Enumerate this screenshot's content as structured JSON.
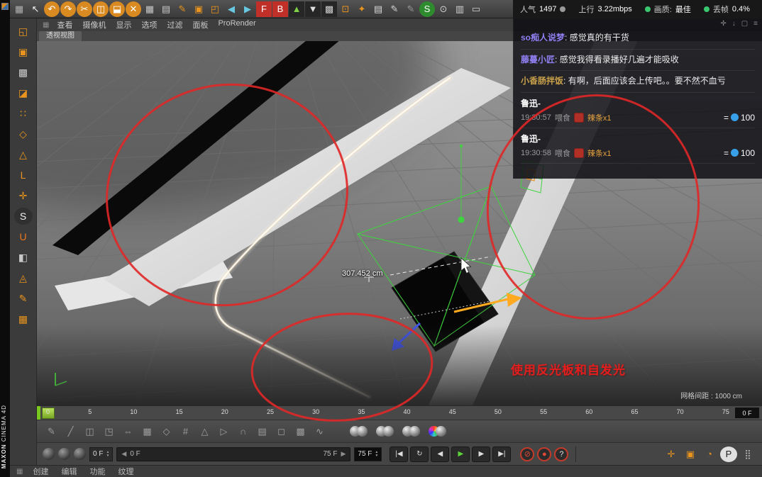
{
  "colors": {
    "green": "#3ac86e",
    "gray": "#9a9a9a",
    "blue": "#38a0e8",
    "annotation_red": "#e51d1d"
  },
  "brand": {
    "maxon": "MAXON",
    "cinema": "CINEMA 4D"
  },
  "stats": {
    "popularity_label": "人气",
    "popularity_value": "1497",
    "upload_label": "上行",
    "upload_value": "3.22mbps",
    "quality_label": "画质:",
    "quality_value": "最佳",
    "dropframe_label": "丢帧",
    "dropframe_value": "0.4%"
  },
  "topbar": {
    "icons": [
      {
        "name": "snap-grid-icon",
        "glyph": "▦",
        "fg": "#b0b0b0"
      },
      {
        "name": "cursor-icon",
        "glyph": "↖",
        "fg": "#f0f0f0"
      },
      {
        "name": "undo-icon",
        "glyph": "↶",
        "fg": "#fff",
        "bg": "#d98a20",
        "radius": "50%"
      },
      {
        "name": "redo-icon",
        "glyph": "↷",
        "fg": "#fff",
        "bg": "#d98a20",
        "radius": "50%"
      },
      {
        "name": "cut-icon",
        "glyph": "✂",
        "fg": "#fff",
        "bg": "#d98a20",
        "radius": "50%"
      },
      {
        "name": "copy-icon",
        "glyph": "◫",
        "fg": "#fff",
        "bg": "#d98a20",
        "radius": "50%"
      },
      {
        "name": "paste-icon",
        "glyph": "⬓",
        "fg": "#fff",
        "bg": "#d98a20",
        "radius": "50%"
      },
      {
        "name": "delete-icon",
        "glyph": "✕",
        "fg": "#fff",
        "bg": "#d98a20",
        "radius": "50%"
      },
      {
        "name": "workplane-icon",
        "glyph": "▦",
        "fg": "#c8c8c8"
      },
      {
        "name": "modeling-axis-icon",
        "glyph": "▤",
        "fg": "#c8c8c8"
      },
      {
        "name": "make-editable-icon",
        "glyph": "✎",
        "fg": "#e8941e"
      },
      {
        "name": "model-cube-icon",
        "glyph": "▣",
        "fg": "#e8941e"
      },
      {
        "name": "array-cube-icon",
        "glyph": "◰",
        "fg": "#e8941e"
      },
      {
        "name": "nav-back-icon",
        "glyph": "◀",
        "fg": "#68c8e0"
      },
      {
        "name": "nav-forward-icon",
        "glyph": "▶",
        "fg": "#68c8e0"
      },
      {
        "name": "front-view-icon",
        "glyph": "F",
        "fg": "#fff",
        "bg": "#c03028"
      },
      {
        "name": "back-view-icon",
        "glyph": "B",
        "fg": "#fff",
        "bg": "#c03028"
      },
      {
        "name": "arrow-up-icon",
        "glyph": "▲",
        "fg": "#7ed048",
        "bg": "#262626"
      },
      {
        "name": "arrow-down-icon",
        "glyph": "▼",
        "fg": "#e0e0e0",
        "bg": "#262626"
      },
      {
        "name": "checker-icon",
        "glyph": "▩",
        "fg": "#d0d0d0",
        "bg": "#262626"
      },
      {
        "name": "target-icon",
        "glyph": "⊡",
        "fg": "#e8941e"
      },
      {
        "name": "star-icon",
        "glyph": "✦",
        "fg": "#e8941e"
      },
      {
        "name": "render-doc-icon",
        "glyph": "▤",
        "fg": "#d8d8d8"
      },
      {
        "name": "pen-a-icon",
        "glyph": "✎",
        "fg": "#d8d8d8"
      },
      {
        "name": "pen-b-icon",
        "glyph": "✎",
        "fg": "#989898"
      },
      {
        "name": "shader-ball-icon",
        "glyph": "S",
        "fg": "#fff",
        "bg": "#2e8c2e",
        "radius": "50%"
      },
      {
        "name": "picker-icon",
        "glyph": "⊙",
        "fg": "#d0d0d0"
      },
      {
        "name": "layers-icon",
        "glyph": "▥",
        "fg": "#d0d0d0"
      },
      {
        "name": "screen-icon",
        "glyph": "▭",
        "fg": "#d0d0d0"
      }
    ]
  },
  "menubar": {
    "items": [
      "查看",
      "摄像机",
      "显示",
      "选项",
      "过滤",
      "面板",
      "ProRender"
    ]
  },
  "left_toolbar": {
    "icons": [
      {
        "name": "convert-editable-icon",
        "glyph": "◱",
        "fg": "#e8941e"
      },
      {
        "name": "model-mode-icon",
        "glyph": "▣",
        "fg": "#e8941e"
      },
      {
        "name": "texture-mode-icon",
        "glyph": "▩",
        "fg": "#c8c8c8"
      },
      {
        "name": "workplane-mode-icon",
        "glyph": "◪",
        "fg": "#e8941e"
      },
      {
        "name": "points-mode-icon",
        "glyph": "∷",
        "fg": "#e8941e"
      },
      {
        "name": "edges-mode-icon",
        "glyph": "◇",
        "fg": "#e8941e"
      },
      {
        "name": "polygons-mode-icon",
        "glyph": "△",
        "fg": "#e8941e"
      },
      {
        "name": "axis-mode-icon",
        "glyph": "L",
        "fg": "#e8941e"
      },
      {
        "name": "object-axis-icon",
        "glyph": "✛",
        "fg": "#e8941e"
      },
      {
        "name": "scale-tool-icon",
        "glyph": "S",
        "fg": "#f0f0f0",
        "bg": "#303030",
        "radius": "50%"
      },
      {
        "name": "snap-magnet-icon",
        "glyph": "U",
        "fg": "#e87820"
      },
      {
        "name": "lock-workplane-icon",
        "glyph": "◧",
        "fg": "#c8c8c8"
      },
      {
        "name": "quantize-icon",
        "glyph": "◬",
        "fg": "#e8941e"
      },
      {
        "name": "brush-icon",
        "glyph": "✎",
        "fg": "#e8941e"
      },
      {
        "name": "clapper-icon",
        "glyph": "▦",
        "fg": "#e8941e"
      }
    ]
  },
  "viewport": {
    "tab": "透视视图",
    "measurement": "307.452 cm",
    "grid_note": "网格间距 : 1000 cm"
  },
  "annotation": {
    "text": "使用反光板和自发光"
  },
  "chat": {
    "colon": ": ",
    "eq": "=",
    "header_icons": [
      {
        "name": "chat-move-icon",
        "glyph": "✛"
      },
      {
        "name": "chat-download-icon",
        "glyph": "↓"
      },
      {
        "name": "chat-window-icon",
        "glyph": "▢"
      },
      {
        "name": "chat-menu-icon",
        "glyph": "≡"
      }
    ],
    "messages": [
      {
        "user": "so痴人说梦",
        "color": "#8f7ff0",
        "text": "感觉真的有干货"
      },
      {
        "user": "藤蔓小匠",
        "color": "#8f7ff0",
        "text": "感觉我得看录播好几遍才能吸收"
      },
      {
        "user": "小香肠拌饭",
        "color": "#c8a04a",
        "text": "有啊，后面应该会上传吧。。要不然不血亏"
      }
    ],
    "gifts": [
      {
        "user": "鲁迅-",
        "time": "19:30:57",
        "action": "喂食",
        "gift": "辣条x1",
        "amount": "100"
      },
      {
        "user": "鲁迅-",
        "time": "19:30:58",
        "action": "喂食",
        "gift": "辣条x1",
        "amount": "100"
      }
    ]
  },
  "timeline": {
    "ticks": [
      "0",
      "5",
      "10",
      "15",
      "20",
      "25",
      "30",
      "35",
      "40",
      "45",
      "50",
      "55",
      "60",
      "65",
      "70",
      "75"
    ],
    "current": "0 F"
  },
  "row2": {
    "icons": [
      {
        "name": "pen-tool-icon",
        "glyph": "✎"
      },
      {
        "name": "knife-tool-icon",
        "glyph": "╱"
      },
      {
        "name": "bridge-tool-icon",
        "glyph": "◫"
      },
      {
        "name": "extrude-tool-icon",
        "glyph": "◳"
      },
      {
        "name": "slide-tool-icon",
        "glyph": "⇔"
      },
      {
        "name": "subdivide-icon",
        "glyph": "▦"
      },
      {
        "name": "bevel-tool-icon",
        "glyph": "◇"
      },
      {
        "name": "lattice-tool-icon",
        "glyph": "#"
      },
      {
        "name": "triangulate-icon",
        "glyph": "△"
      },
      {
        "name": "normal-move-icon",
        "glyph": "▷"
      },
      {
        "name": "arc-tool-icon",
        "glyph": "∩"
      },
      {
        "name": "matrix-tool-icon",
        "glyph": "▤"
      },
      {
        "name": "untriangulate-icon",
        "glyph": "◻"
      },
      {
        "name": "weld-tool-icon",
        "glyph": "▩"
      },
      {
        "name": "spline-tool-icon",
        "glyph": "∿"
      }
    ]
  },
  "playback": {
    "frame_start": "0 F",
    "range_left": "0 F",
    "range_right": "75 F",
    "frame_end": "75 F",
    "left_arrow": "◀",
    "right_arrow": "▶",
    "spin_up": "▲",
    "spin_down": "▼",
    "transport": [
      {
        "name": "goto-start-button",
        "glyph": "|◀"
      },
      {
        "name": "play-reverse-button",
        "glyph": "↻"
      },
      {
        "name": "previous-frame-button",
        "glyph": "◀"
      },
      {
        "name": "play-button",
        "glyph": "▶",
        "fg": "#5ed43a"
      },
      {
        "name": "next-frame-button",
        "glyph": "▶"
      },
      {
        "name": "goto-end-button",
        "glyph": "▶|"
      }
    ],
    "record": [
      {
        "name": "record-position-button",
        "glyph": "⊘",
        "fg": "#e04838"
      },
      {
        "name": "record-keyframe-button",
        "glyph": "●",
        "fg": "#e04838"
      },
      {
        "name": "autokey-help-button",
        "glyph": "?",
        "fg": "#e0e0e0"
      }
    ],
    "right_icons": [
      {
        "name": "snap-move-icon",
        "glyph": "✛",
        "fg": "#e8941e"
      },
      {
        "name": "solo-cube-icon",
        "glyph": "▣",
        "fg": "#e8941e"
      },
      {
        "name": "time-clock-icon",
        "glyph": "◔",
        "fg": "#e8941e"
      },
      {
        "name": "parameter-icon",
        "glyph": "P",
        "fg": "#1c1c1c",
        "bg": "#e0e0e0",
        "radius": "50%"
      },
      {
        "name": "dots-grid-icon",
        "glyph": "⣿",
        "fg": "#b8b8b8"
      }
    ]
  },
  "statusbar": {
    "items": [
      "创建",
      "编辑",
      "功能",
      "纹理"
    ]
  }
}
